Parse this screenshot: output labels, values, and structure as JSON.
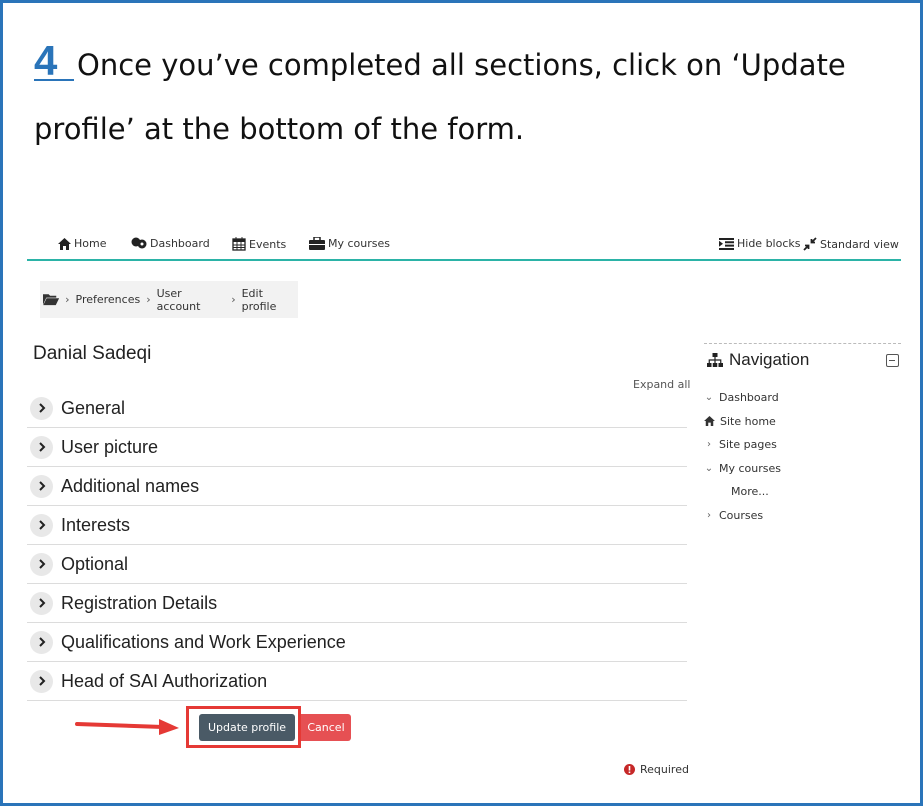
{
  "instruction": {
    "step": "4",
    "text": "Once you’ve completed all sections, click on ‘Update profile’ at the bottom of the form."
  },
  "topnav": {
    "home": "Home",
    "dashboard": "Dashboard",
    "events": "Events",
    "my_courses": "My courses",
    "hide_blocks": "Hide blocks",
    "standard_view": "Standard view"
  },
  "breadcrumb": [
    "Preferences",
    "User account",
    "Edit profile"
  ],
  "page_title": "Danial Sadeqi",
  "expand_all": "Expand all",
  "sections": [
    "General",
    "User picture",
    "Additional names",
    "Interests",
    "Optional",
    "Registration Details",
    "Qualifications and Work Experience",
    "Head of SAI Authorization"
  ],
  "buttons": {
    "update": "Update profile",
    "cancel": "Cancel"
  },
  "required": "Required",
  "navigation": {
    "title": "Navigation",
    "items": [
      "Dashboard",
      "Site home",
      "Site pages",
      "My courses",
      "More...",
      "Courses"
    ]
  },
  "colors": {
    "accent": "#2a74b9",
    "teal": "#2bb3a7",
    "highlight": "#e53935",
    "update_btn": "#4a5a66",
    "cancel_btn": "#e65053"
  }
}
